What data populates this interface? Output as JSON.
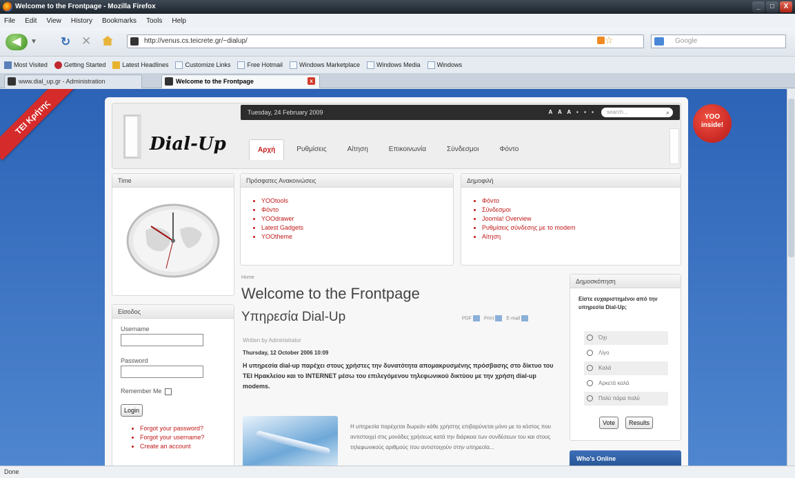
{
  "window": {
    "title": "Welcome to the Frontpage - Mozilla Firefox",
    "buttons": [
      "_",
      "□",
      "X"
    ]
  },
  "menu": [
    "File",
    "Edit",
    "View",
    "History",
    "Bookmarks",
    "Tools",
    "Help"
  ],
  "toolbar": {
    "url": "http://venus.cs.teicrete.gr/~dialup/",
    "search_placeholder": "Google"
  },
  "bookmarks": [
    "Most Visited",
    "Getting Started",
    "Latest Headlines",
    "Customize Links",
    "Free Hotmail",
    "Windows Marketplace",
    "Windows Media",
    "Windows"
  ],
  "tabs": [
    {
      "label": "www.dial_up.gr - Administration"
    },
    {
      "label": "Welcome to the Frontpage"
    }
  ],
  "status": "Done",
  "site": {
    "ribbon": "ΤΕΙ Κρήτης",
    "badge": "YOO inside!",
    "logo": "Dial-Up",
    "date": "Tuesday, 24 February 2009",
    "fontsizes": "A A A ▪ ▪ ▪",
    "search": "search...",
    "nav": [
      "Αρχή",
      "Ρυθμίσεις",
      "Αίτηση",
      "Επικοινωνία",
      "Σύνδεσμοι",
      "Φόντο"
    ],
    "clock_title": "Time",
    "login": {
      "title": "Είσοδος",
      "username_label": "Username",
      "password_label": "Password",
      "remember": "Remember Me",
      "button": "Login",
      "links": [
        "Forgot your password?",
        "Forgot your username?",
        "Create an account"
      ]
    },
    "mod_left": {
      "title": "Πρόσφατες Ανακοινώσεις",
      "items": [
        "YOOtools",
        "Φόντο",
        "YOOdrawer",
        "Latest Gadgets",
        "YOOtheme"
      ]
    },
    "mod_right": {
      "title": "Δημοφιλή",
      "items": [
        "Φόντο",
        "Σύνδεσμοι",
        "Joomla! Overview",
        "Ρυθμίσεις σύνδεσης με το modem",
        "Αίτηση"
      ]
    },
    "article": {
      "breadcrumb": "Home",
      "title": "Welcome to the Frontpage",
      "subtitle": "Υπηρεσία Dial-Up",
      "icons": [
        "PDF",
        "Print",
        "E-mail"
      ],
      "author": "Written by Administrator",
      "date": "Thursday, 12 October 2006 10:09",
      "intro": "Η υπηρεσία dial-up παρέχει στους χρήστες την δυνατότητα απομακρυσμένης πρόσβασης στο δίκτυο του ΤΕΙ Ηρακλείου και το INTERNET μέσω του επιλεγόμενου τηλεφωνικού δικτύου με την χρήση dial-up modems.",
      "body": "Η υπηρεσία παρέχεται δωρεάν κάθε χρήστης επιβαρύνεται μόνο με το κόστος που αντιστοιχεί στις μονάδες χρήσεως κατά την διάρκεια των συνδέσεων του και στους τηλεφωνικούς αριθμούς που αντιστοιχούν στην υπηρεσία..."
    },
    "poll": {
      "title": "Δημοσκόπηση",
      "question": "Είστε ευχαριστημένοι από την υπηρεσία Dial-Up;",
      "options": [
        "Όχι",
        "Λίγο",
        "Καλά",
        "Αρκετά καλά",
        "Πολύ πάρα πολύ"
      ],
      "vote": "Vote",
      "results": "Results"
    },
    "whos_online": "Who's Online"
  }
}
